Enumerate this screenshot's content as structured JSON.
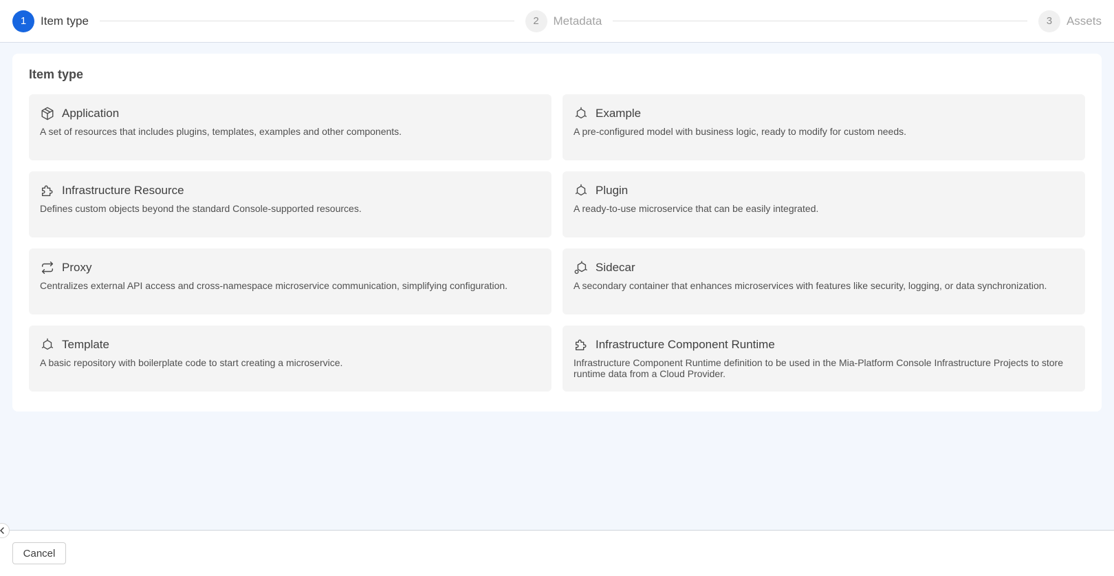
{
  "stepper": {
    "steps": [
      {
        "number": "1",
        "label": "Item type",
        "active": true
      },
      {
        "number": "2",
        "label": "Metadata",
        "active": false
      },
      {
        "number": "3",
        "label": "Assets",
        "active": false
      }
    ]
  },
  "card": {
    "title": "Item type",
    "options": [
      {
        "icon": "package-icon",
        "title": "Application",
        "description": "A set of resources that includes plugins, templates, examples and other components."
      },
      {
        "icon": "microservice-icon",
        "title": "Example",
        "description": "A pre-configured model with business logic, ready to modify for custom needs."
      },
      {
        "icon": "puzzle-icon",
        "title": "Infrastructure Resource",
        "description": "Defines custom objects beyond the standard Console-supported resources."
      },
      {
        "icon": "microservice-icon",
        "title": "Plugin",
        "description": "A ready-to-use microservice that can be easily integrated."
      },
      {
        "icon": "swap-arrows-icon",
        "title": "Proxy",
        "description": "Centralizes external API access and cross-namespace microservice communication, simplifying configuration."
      },
      {
        "icon": "sidecar-icon",
        "title": "Sidecar",
        "description": "A secondary container that enhances microservices with features like security, logging, or data synchronization."
      },
      {
        "icon": "microservice-icon",
        "title": "Template",
        "description": "A basic repository with boilerplate code to start creating a microservice."
      },
      {
        "icon": "puzzle-icon",
        "title": "Infrastructure Component Runtime",
        "description": "Infrastructure Component Runtime definition to be used in the Mia-Platform Console Infrastructure Projects to store runtime data from a Cloud Provider."
      }
    ]
  },
  "footer": {
    "cancel_label": "Cancel"
  },
  "colors": {
    "accent": "#1766e0",
    "main_background": "#f3f7fd",
    "option_background": "#f4f4f4"
  }
}
